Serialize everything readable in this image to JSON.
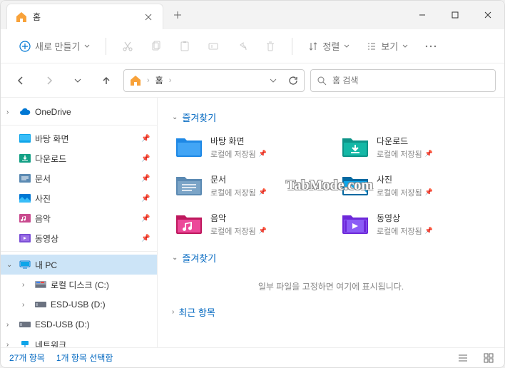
{
  "tab": {
    "title": "홈"
  },
  "toolbar": {
    "new": "새로 만들기",
    "sort": "정렬",
    "view": "보기"
  },
  "address": {
    "root": "홈"
  },
  "search": {
    "placeholder": "홈 검색"
  },
  "sidebar": {
    "onedrive": "OneDrive",
    "quick": [
      {
        "label": "바탕 화면"
      },
      {
        "label": "다운로드"
      },
      {
        "label": "문서"
      },
      {
        "label": "사진"
      },
      {
        "label": "음악"
      },
      {
        "label": "동영상"
      }
    ],
    "pc": "내 PC",
    "drives": [
      {
        "label": "로컬 디스크 (C:)"
      },
      {
        "label": "ESD-USB (D:)"
      },
      {
        "label": "ESD-USB (D:)"
      }
    ],
    "network": "네트워크"
  },
  "sections": {
    "favorites": "즐겨찾기",
    "favorites2": "즐겨찾기",
    "recent": "최근 항목"
  },
  "grid_items": [
    {
      "title": "바탕 화면",
      "sub": "로컬에 저장됨"
    },
    {
      "title": "다운로드",
      "sub": "로컬에 저장됨"
    },
    {
      "title": "문서",
      "sub": "로컬에 저장됨"
    },
    {
      "title": "사진",
      "sub": "로컬에 저장됨"
    },
    {
      "title": "음악",
      "sub": "로컬에 저장됨"
    },
    {
      "title": "동영상",
      "sub": "로컬에 저장됨"
    }
  ],
  "empty_favorites": "일부 파일을 고정하면 여기에 표시됩니다.",
  "status": {
    "count": "27개 항목",
    "selected": "1개 항목 선택함"
  },
  "watermark": "TabMode.com"
}
